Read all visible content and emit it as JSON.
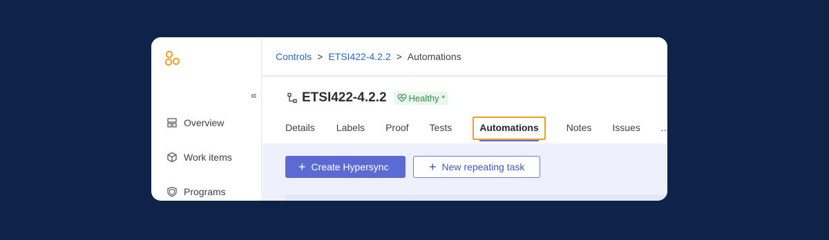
{
  "sidebar": {
    "collapse_glyph": "«",
    "items": [
      {
        "label": "Overview",
        "icon": "layout-icon"
      },
      {
        "label": "Work items",
        "icon": "box-icon"
      },
      {
        "label": "Programs",
        "icon": "shield-icon"
      }
    ]
  },
  "breadcrumb": {
    "items": [
      "Controls",
      "ETSI422-4.2.2",
      "Automations"
    ],
    "separator": ">"
  },
  "header": {
    "title": "ETSI422-4.2.2",
    "status": "Healthy *"
  },
  "tabs": [
    "Details",
    "Labels",
    "Proof",
    "Tests",
    "Automations",
    "Notes",
    "Issues",
    "..."
  ],
  "active_tab": "Automations",
  "actions": {
    "create_hypersync": "Create Hypersync",
    "new_repeating_task": "New repeating task"
  },
  "colors": {
    "background": "#0f2248",
    "accent": "#5c6bd3",
    "highlight": "#f29c1b",
    "link": "#2b66c6",
    "healthy": "#2f8a4c"
  }
}
